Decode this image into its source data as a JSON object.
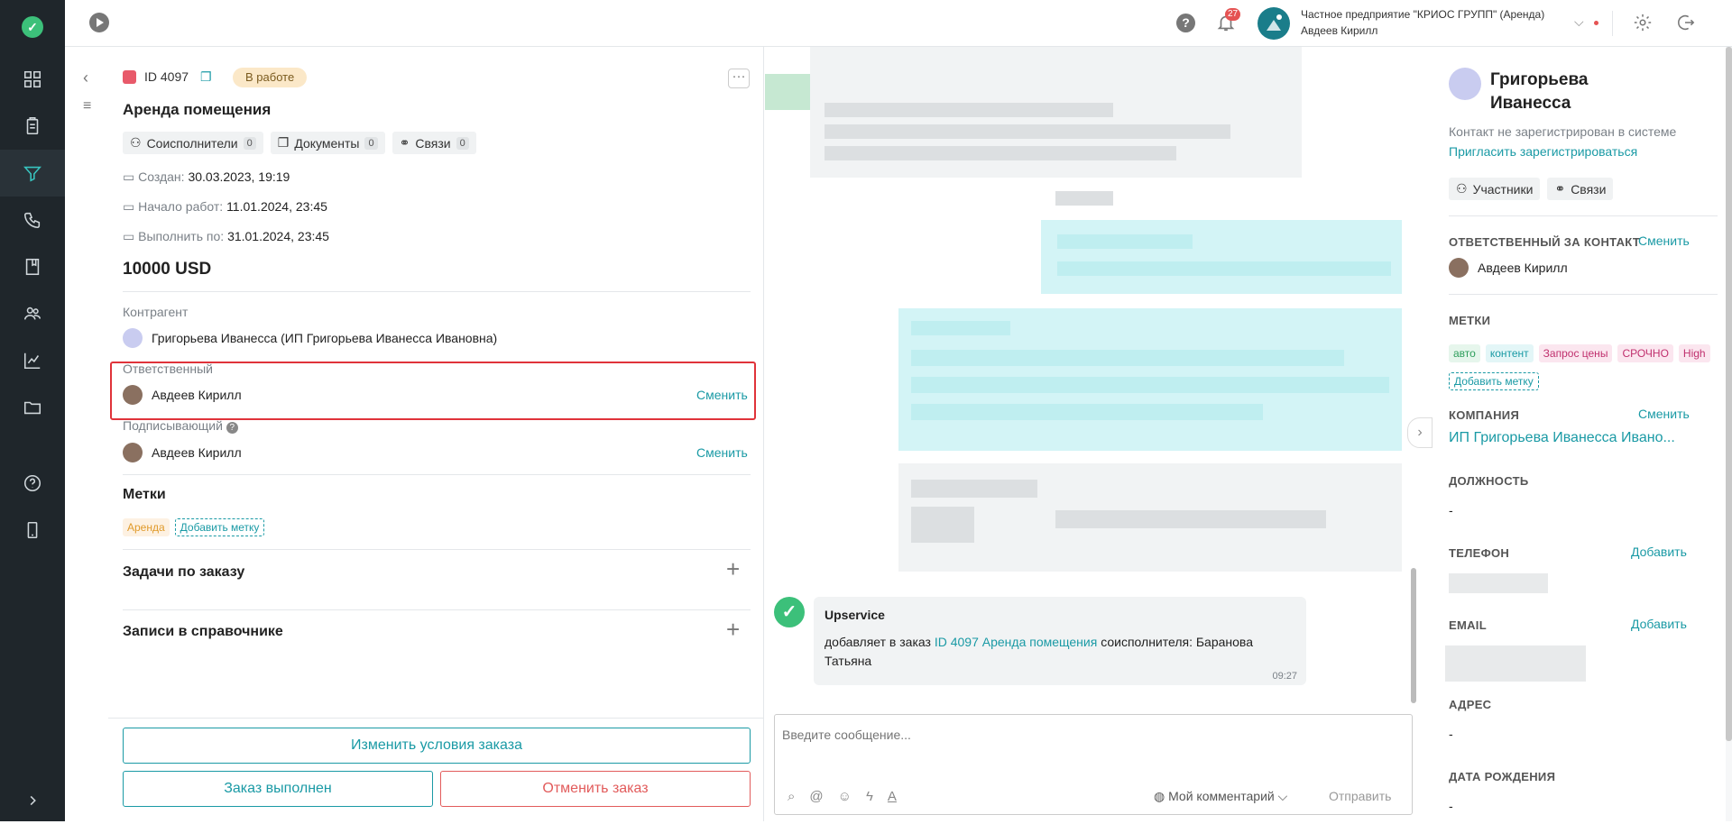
{
  "topbar": {
    "notif_count": "27",
    "company": "Частное предприятие \"КРИОС ГРУПП\" (Аренда)",
    "user": "Авдеев Кирилл"
  },
  "order": {
    "id": "ID 4097",
    "status": "В работе",
    "title": "Аренда помещения",
    "chips": [
      {
        "label": "Соисполнители",
        "count": "0"
      },
      {
        "label": "Документы",
        "count": "0"
      },
      {
        "label": "Связи",
        "count": "0"
      }
    ],
    "created_label": "Создан:",
    "created": "30.03.2023, 19:19",
    "start_label": "Начало работ:",
    "start": "11.01.2024, 23:45",
    "due_label": "Выполнить по:",
    "due": "31.01.2024, 23:45",
    "amount": "10000 USD",
    "counterparty_label": "Контрагент",
    "counterparty": "Григорьева Иванесса (ИП Григорьева Иванесса Ивановна)",
    "responsible_label": "Ответственный",
    "responsible": "Авдеев Кирилл",
    "change": "Сменить",
    "signer_label": "Подписывающий",
    "signer": "Авдеев Кирилл",
    "tags_label": "Метки",
    "tag": "Аренда",
    "add_tag": "Добавить метку",
    "tasks_label": "Задачи по заказу",
    "records_label": "Записи в справочнике",
    "btn_change": "Изменить условия заказа",
    "btn_done": "Заказ выполнен",
    "btn_cancel": "Отменить заказ"
  },
  "chat": {
    "sender": "Upservice",
    "msg_prefix": "добавляет в заказ ",
    "msg_link": "ID 4097 Аренда помещения",
    "msg_suffix": " соисполнителя: Баранова Татьяна",
    "time": "09:27",
    "placeholder": "Введите сообщение...",
    "comment_mode": "Мой комментарий",
    "send": "Отправить"
  },
  "contact": {
    "name": "Григорьева Иванесса",
    "not_registered": "Контакт не зарегистрирован в системе",
    "invite": "Пригласить зарегистрироваться",
    "participants": "Участники",
    "links": "Связи",
    "responsible_label": "ОТВЕТСТВЕННЫЙ ЗА КОНТАКТ",
    "change": "Сменить",
    "responsible": "Авдеев Кирилл",
    "tags_label": "МЕТКИ",
    "tags": [
      {
        "label": "авто",
        "color": "#2e9e5b",
        "bg": "#e6f6ec"
      },
      {
        "label": "контент",
        "color": "#1a9aa5",
        "bg": "#e3f6f7"
      },
      {
        "label": "Запрос цены",
        "color": "#c0306e",
        "bg": "#fbe6ef"
      },
      {
        "label": "СРОЧНО",
        "color": "#c0306e",
        "bg": "#fbe6ef"
      },
      {
        "label": "High",
        "color": "#c0306e",
        "bg": "#fbe6ef"
      }
    ],
    "add_tag": "Добавить метку",
    "company_label": "КОМПАНИЯ",
    "company": "ИП Григорьева Иванесса Ивано...",
    "position_label": "ДОЛЖНОСТЬ",
    "position": "-",
    "phone_label": "ТЕЛЕФОН",
    "add": "Добавить",
    "email_label": "EMAIL",
    "address_label": "АДРЕС",
    "address": "-",
    "birth_label": "ДАТА РОЖДЕНИЯ",
    "birth": "-"
  },
  "colors": {
    "accent": "#1a9aa5",
    "danger": "#e25b5b",
    "sidebar": "#1f262b"
  }
}
